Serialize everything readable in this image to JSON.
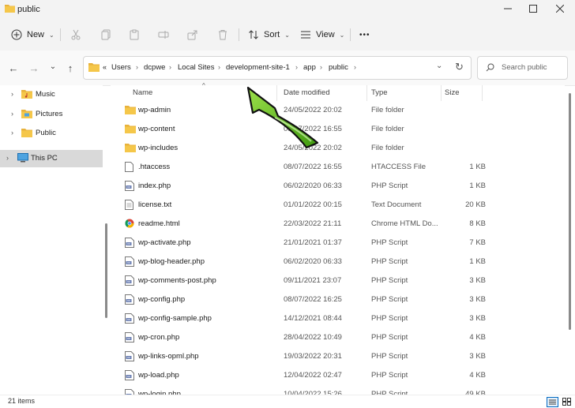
{
  "window": {
    "title": "public",
    "colors": {
      "accent": "#0067c0",
      "folder": "#e8b23c",
      "arrow": "#6cc31e"
    }
  },
  "toolbar": {
    "new_label": "New",
    "sort_label": "Sort",
    "view_label": "View",
    "more_label": "•••"
  },
  "nav": {
    "back": "←",
    "forward": "→",
    "recent": "⌄",
    "up": "↑"
  },
  "address": {
    "overflow": "«",
    "crumbs": [
      "Users",
      "dcpwe",
      "Local Sites",
      "development-site-1",
      "app",
      "public"
    ],
    "refresh": "↻"
  },
  "search": {
    "placeholder": "Search public"
  },
  "sidebar": {
    "items": [
      {
        "label": "Music"
      },
      {
        "label": "Pictures"
      },
      {
        "label": "Public"
      },
      {
        "label": "This PC"
      }
    ]
  },
  "columns": {
    "name": "Name",
    "date": "Date modified",
    "type": "Type",
    "size": "Size"
  },
  "files": [
    {
      "name": "wp-admin",
      "date": "24/05/2022 20:02",
      "type": "File folder",
      "size": "",
      "icon": "folder-icon"
    },
    {
      "name": "wp-content",
      "date": "08/07/2022 16:55",
      "type": "File folder",
      "size": "",
      "icon": "folder-icon"
    },
    {
      "name": "wp-includes",
      "date": "24/05/2022 20:02",
      "type": "File folder",
      "size": "",
      "icon": "folder-icon"
    },
    {
      "name": ".htaccess",
      "date": "08/07/2022 16:55",
      "type": "HTACCESS File",
      "size": "1 KB",
      "icon": "file-icon"
    },
    {
      "name": "index.php",
      "date": "06/02/2020 06:33",
      "type": "PHP Script",
      "size": "1 KB",
      "icon": "php-file-icon"
    },
    {
      "name": "license.txt",
      "date": "01/01/2022 00:15",
      "type": "Text Document",
      "size": "20 KB",
      "icon": "text-file-icon"
    },
    {
      "name": "readme.html",
      "date": "22/03/2022 21:11",
      "type": "Chrome HTML Do...",
      "size": "8 KB",
      "icon": "chrome-icon"
    },
    {
      "name": "wp-activate.php",
      "date": "21/01/2021 01:37",
      "type": "PHP Script",
      "size": "7 KB",
      "icon": "php-file-icon"
    },
    {
      "name": "wp-blog-header.php",
      "date": "06/02/2020 06:33",
      "type": "PHP Script",
      "size": "1 KB",
      "icon": "php-file-icon"
    },
    {
      "name": "wp-comments-post.php",
      "date": "09/11/2021 23:07",
      "type": "PHP Script",
      "size": "3 KB",
      "icon": "php-file-icon"
    },
    {
      "name": "wp-config.php",
      "date": "08/07/2022 16:25",
      "type": "PHP Script",
      "size": "3 KB",
      "icon": "php-file-icon"
    },
    {
      "name": "wp-config-sample.php",
      "date": "14/12/2021 08:44",
      "type": "PHP Script",
      "size": "3 KB",
      "icon": "php-file-icon"
    },
    {
      "name": "wp-cron.php",
      "date": "28/04/2022 10:49",
      "type": "PHP Script",
      "size": "4 KB",
      "icon": "php-file-icon"
    },
    {
      "name": "wp-links-opml.php",
      "date": "19/03/2022 20:31",
      "type": "PHP Script",
      "size": "3 KB",
      "icon": "php-file-icon"
    },
    {
      "name": "wp-load.php",
      "date": "12/04/2022 02:47",
      "type": "PHP Script",
      "size": "4 KB",
      "icon": "php-file-icon"
    },
    {
      "name": "wp-login.php",
      "date": "10/04/2022 15:26",
      "type": "PHP Script",
      "size": "49 KB",
      "icon": "php-file-icon"
    }
  ],
  "status": {
    "item_count": "21 items"
  }
}
